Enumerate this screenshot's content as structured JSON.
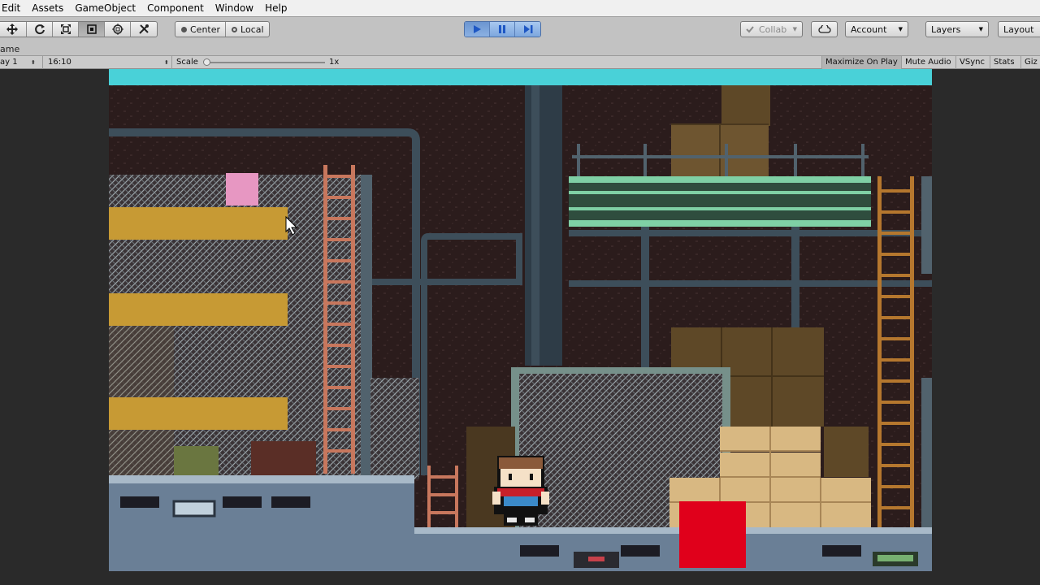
{
  "menu": {
    "items": [
      "Edit",
      "Assets",
      "GameObject",
      "Component",
      "Window",
      "Help"
    ]
  },
  "toolbar": {
    "tools": [
      "hand-tool",
      "move-tool",
      "rotate-tool",
      "scale-tool",
      "rect-tool",
      "transform-tool",
      "custom-tool"
    ],
    "active_tool": "rect-tool",
    "pivot_center_label": "Center",
    "pivot_local_label": "Local",
    "playing": true,
    "collab_label": "Collab",
    "account_label": "Account",
    "layers_label": "Layers",
    "layout_label": "Layout"
  },
  "tab": {
    "label": "ame"
  },
  "gameview": {
    "display_label": "ay 1",
    "aspect_label": "16:10",
    "scale_label": "Scale",
    "scale_value": "1x",
    "toggles": {
      "maximize": "Maximize On Play",
      "mute": "Mute Audio",
      "vsync": "VSync",
      "stats": "Stats",
      "gizmos": "Giz"
    },
    "maximize_on": true
  },
  "colors": {
    "top_band": "#49d1d8",
    "player_hitbox": "#e0001b",
    "pink_block": "#e797c2",
    "yellow_platform": "#c79a34"
  }
}
